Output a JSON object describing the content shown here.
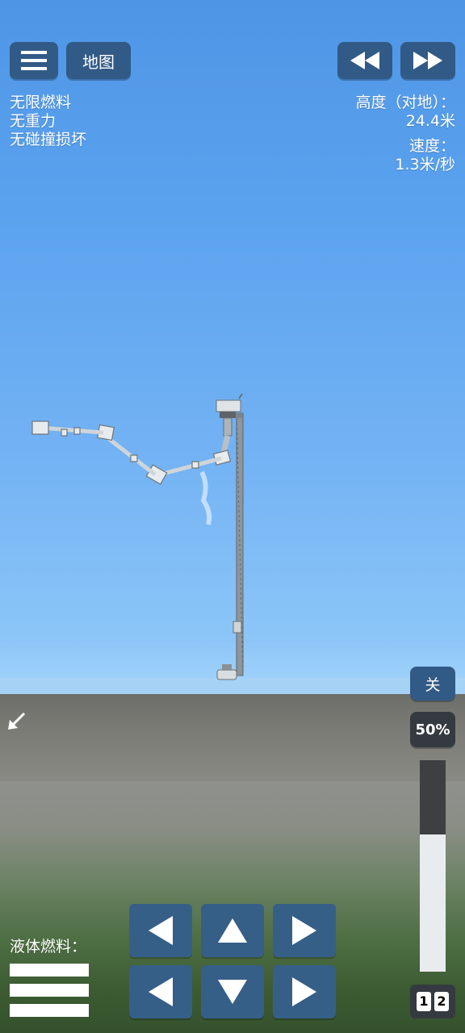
{
  "topbar": {
    "menu_icon": "hamburger-menu-icon",
    "map_label": "地图",
    "rewind_icon": "rewind-icon",
    "fast_forward_icon": "fast-forward-icon"
  },
  "cheats": [
    "无限燃料",
    "无重力",
    "无碰撞损坏"
  ],
  "telemetry": {
    "altitude_label": "高度（对地）：",
    "altitude_value": "24.4米",
    "speed_label": "速度：",
    "speed_value": "1.3米/秒"
  },
  "right_panel": {
    "toggle_label": "关",
    "throttle_label": "50%",
    "throttle_fraction": 0.5
  },
  "fuel": {
    "label": "液体燃料：",
    "bars": 3
  },
  "stage_buttons": [
    "1",
    "2"
  ],
  "colors": {
    "button_bg": "#325a86",
    "ground": "#7a7a75",
    "text": "#ffffff"
  }
}
